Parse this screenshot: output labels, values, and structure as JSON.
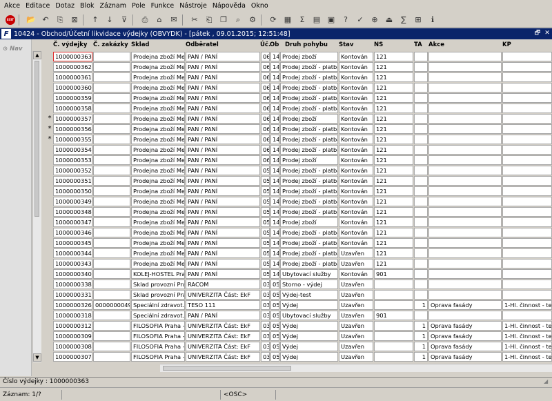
{
  "menu": [
    "Akce",
    "Editace",
    "Dotaz",
    "Blok",
    "Záznam",
    "Pole",
    "Funkce",
    "Nástroje",
    "Nápověda",
    "Okno"
  ],
  "toolbar": {
    "exit_label": "EXIT",
    "icons": [
      "open-icon",
      "back-icon",
      "copy-record-icon",
      "delete-record-icon",
      "sort-asc-icon",
      "sort-desc-icon",
      "filter-icon",
      "print-icon",
      "attach-icon",
      "mail-icon",
      "cut-icon",
      "paste-icon",
      "copy-icon",
      "search-icon",
      "settings-icon",
      "refresh-icon",
      "calculator-icon",
      "sum-icon",
      "chart-icon",
      "calendar-icon",
      "help-icon",
      "spellcheck-icon",
      "zoom-icon",
      "exit-icon",
      "sigma-icon",
      "excel-icon",
      "info-icon"
    ]
  },
  "window": {
    "logo": "F",
    "title": "10424 - Obchod/Účetní likvidace výdejky (OBVYDK) - [pátek  , 09.01.2015; 12:51:48]",
    "buttons": [
      "restore-icon",
      "close-icon"
    ],
    "restore_glyph": "🗗",
    "close_glyph": "✕"
  },
  "nav": {
    "label": "Nav"
  },
  "grid": {
    "columns": [
      "Č. výdejky",
      "Č. zakázky",
      "Sklad",
      "Odběratel",
      "Úč.",
      "Ob",
      "Druh pohybu",
      "Stav",
      "NS",
      "TA",
      "Akce",
      "KP"
    ],
    "rows": [
      {
        "mark": "",
        "vyd": "1000000363",
        "zak": "",
        "sklad": "Prodejna zboží Med",
        "odb": "PAN / PANÍ",
        "uc": "06",
        "ob": "14",
        "druh": "Prodej zboží",
        "stav": "Kontován",
        "ns": "121",
        "ta": "",
        "akce": "",
        "kp": ""
      },
      {
        "mark": "",
        "vyd": "1000000362",
        "zak": "",
        "sklad": "Prodejna zboží Med",
        "odb": "PAN / PANÍ",
        "uc": "06",
        "ob": "14",
        "druh": "Prodej zboží - platba k",
        "stav": "Kontován",
        "ns": "121",
        "ta": "",
        "akce": "",
        "kp": ""
      },
      {
        "mark": "",
        "vyd": "1000000361",
        "zak": "",
        "sklad": "Prodejna zboží Med",
        "odb": "PAN / PANÍ",
        "uc": "06",
        "ob": "14",
        "druh": "Prodej zboží - platba k",
        "stav": "Kontován",
        "ns": "121",
        "ta": "",
        "akce": "",
        "kp": ""
      },
      {
        "mark": "",
        "vyd": "1000000360",
        "zak": "",
        "sklad": "Prodejna zboží Med",
        "odb": "PAN / PANÍ",
        "uc": "06",
        "ob": "14",
        "druh": "Prodej zboží - platba k",
        "stav": "Kontován",
        "ns": "121",
        "ta": "",
        "akce": "",
        "kp": ""
      },
      {
        "mark": "",
        "vyd": "1000000359",
        "zak": "",
        "sklad": "Prodejna zboží Med",
        "odb": "PAN / PANÍ",
        "uc": "06",
        "ob": "14",
        "druh": "Prodej zboží - platba k",
        "stav": "Kontován",
        "ns": "121",
        "ta": "",
        "akce": "",
        "kp": ""
      },
      {
        "mark": "",
        "vyd": "1000000358",
        "zak": "",
        "sklad": "Prodejna zboží Med",
        "odb": "PAN / PANÍ",
        "uc": "06",
        "ob": "14",
        "druh": "Prodej zboží - platba k",
        "stav": "Kontován",
        "ns": "121",
        "ta": "",
        "akce": "",
        "kp": ""
      },
      {
        "mark": "*",
        "vyd": "1000000357",
        "zak": "",
        "sklad": "Prodejna zboží Med",
        "odb": "PAN / PANÍ",
        "uc": "06",
        "ob": "14",
        "druh": "Prodej zboží",
        "stav": "Kontován",
        "ns": "121",
        "ta": "",
        "akce": "",
        "kp": ""
      },
      {
        "mark": "*",
        "vyd": "1000000356",
        "zak": "",
        "sklad": "Prodejna zboží Med",
        "odb": "PAN / PANÍ",
        "uc": "06",
        "ob": "14",
        "druh": "Prodej zboží - platba k",
        "stav": "Kontován",
        "ns": "121",
        "ta": "",
        "akce": "",
        "kp": ""
      },
      {
        "mark": "*",
        "vyd": "1000000355",
        "zak": "",
        "sklad": "Prodejna zboží Med",
        "odb": "PAN / PANÍ",
        "uc": "06",
        "ob": "14",
        "druh": "Prodej zboží - platba k",
        "stav": "Kontován",
        "ns": "121",
        "ta": "",
        "akce": "",
        "kp": ""
      },
      {
        "mark": "",
        "vyd": "1000000354",
        "zak": "",
        "sklad": "Prodejna zboží Med",
        "odb": "PAN / PANÍ",
        "uc": "06",
        "ob": "14",
        "druh": "Prodej zboží - platba k",
        "stav": "Kontován",
        "ns": "121",
        "ta": "",
        "akce": "",
        "kp": ""
      },
      {
        "mark": "",
        "vyd": "1000000353",
        "zak": "",
        "sklad": "Prodejna zboží Med",
        "odb": "PAN / PANÍ",
        "uc": "06",
        "ob": "14",
        "druh": "Prodej zboží",
        "stav": "Kontován",
        "ns": "121",
        "ta": "",
        "akce": "",
        "kp": ""
      },
      {
        "mark": "",
        "vyd": "1000000352",
        "zak": "",
        "sklad": "Prodejna zboží Med",
        "odb": "PAN / PANÍ",
        "uc": "05",
        "ob": "14",
        "druh": "Prodej zboží - platba k",
        "stav": "Kontován",
        "ns": "121",
        "ta": "",
        "akce": "",
        "kp": ""
      },
      {
        "mark": "",
        "vyd": "1000000351",
        "zak": "",
        "sklad": "Prodejna zboží Med",
        "odb": "PAN / PANÍ",
        "uc": "05",
        "ob": "14",
        "druh": "Prodej zboží - platba k",
        "stav": "Kontován",
        "ns": "121",
        "ta": "",
        "akce": "",
        "kp": ""
      },
      {
        "mark": "",
        "vyd": "1000000350",
        "zak": "",
        "sklad": "Prodejna zboží Med",
        "odb": "PAN / PANÍ",
        "uc": "05",
        "ob": "14",
        "druh": "Prodej zboží - platba k",
        "stav": "Kontován",
        "ns": "121",
        "ta": "",
        "akce": "",
        "kp": ""
      },
      {
        "mark": "",
        "vyd": "1000000349",
        "zak": "",
        "sklad": "Prodejna zboží Med",
        "odb": "PAN / PANÍ",
        "uc": "05",
        "ob": "14",
        "druh": "Prodej zboží - platba k",
        "stav": "Kontován",
        "ns": "121",
        "ta": "",
        "akce": "",
        "kp": ""
      },
      {
        "mark": "",
        "vyd": "1000000348",
        "zak": "",
        "sklad": "Prodejna zboží Med",
        "odb": "PAN / PANÍ",
        "uc": "05",
        "ob": "14",
        "druh": "Prodej zboží - platba k",
        "stav": "Kontován",
        "ns": "121",
        "ta": "",
        "akce": "",
        "kp": ""
      },
      {
        "mark": "",
        "vyd": "1000000347",
        "zak": "",
        "sklad": "Prodejna zboží Med",
        "odb": "PAN / PANÍ",
        "uc": "05",
        "ob": "14",
        "druh": "Prodej zboží",
        "stav": "Kontován",
        "ns": "121",
        "ta": "",
        "akce": "",
        "kp": ""
      },
      {
        "mark": "",
        "vyd": "1000000346",
        "zak": "",
        "sklad": "Prodejna zboží Med",
        "odb": "PAN / PANÍ",
        "uc": "05",
        "ob": "14",
        "druh": "Prodej zboží - platba k",
        "stav": "Kontován",
        "ns": "121",
        "ta": "",
        "akce": "",
        "kp": ""
      },
      {
        "mark": "",
        "vyd": "1000000345",
        "zak": "",
        "sklad": "Prodejna zboží Med",
        "odb": "PAN / PANÍ",
        "uc": "05",
        "ob": "14",
        "druh": "Prodej zboží - platba k",
        "stav": "Kontován",
        "ns": "121",
        "ta": "",
        "akce": "",
        "kp": ""
      },
      {
        "mark": "",
        "vyd": "1000000344",
        "zak": "",
        "sklad": "Prodejna zboží Med",
        "odb": "PAN / PANÍ",
        "uc": "05",
        "ob": "14",
        "druh": "Prodej zboží - platba k",
        "stav": "Uzavřen",
        "ns": "121",
        "ta": "",
        "akce": "",
        "kp": ""
      },
      {
        "mark": "",
        "vyd": "1000000343",
        "zak": "",
        "sklad": "Prodejna zboží Med",
        "odb": "PAN / PANÍ",
        "uc": "05",
        "ob": "14",
        "druh": "Prodej zboží - platba k",
        "stav": "Uzavřen",
        "ns": "121",
        "ta": "",
        "akce": "",
        "kp": ""
      },
      {
        "mark": "",
        "vyd": "1000000340",
        "zak": "",
        "sklad": "KOLEJ-HOSTEL Pra",
        "odb": "PAN / PANÍ",
        "uc": "05",
        "ob": "14",
        "druh": "Ubytovací služby",
        "stav": "Kontován",
        "ns": "901",
        "ta": "",
        "akce": "",
        "kp": ""
      },
      {
        "mark": "",
        "vyd": "1000000338",
        "zak": "",
        "sklad": "Sklad provozní Pra",
        "odb": "RACOM",
        "uc": "03",
        "ob": "05",
        "druh": "Storno - výdej",
        "stav": "Uzavřen",
        "ns": "",
        "ta": "",
        "akce": "",
        "kp": ""
      },
      {
        "mark": "",
        "vyd": "1000000331",
        "zak": "",
        "sklad": "Sklad provozní Pra",
        "odb": "UNIVERZITA Část: EkF",
        "uc": "03",
        "ob": "05",
        "druh": "Výdej-test",
        "stav": "Uzavřen",
        "ns": "",
        "ta": "",
        "akce": "",
        "kp": ""
      },
      {
        "mark": "",
        "vyd": "1000000326",
        "zak": "0000000049",
        "sklad": "Speciální zdravot. n",
        "odb": "TESO 111",
        "uc": "03",
        "ob": "05",
        "druh": "Výdej",
        "stav": "Uzavřen",
        "ns": "",
        "ta": "1",
        "akce": "Oprava fasády",
        "kp": "1-Hl. činnost - tes"
      },
      {
        "mark": "",
        "vyd": "1000000318",
        "zak": "",
        "sklad": "Speciální zdravot. n",
        "odb": "PAN / PANÍ",
        "uc": "03",
        "ob": "05",
        "druh": "Ubytovací služby",
        "stav": "Uzavřen",
        "ns": "901",
        "ta": "",
        "akce": "",
        "kp": ""
      },
      {
        "mark": "",
        "vyd": "1000000312",
        "zak": "",
        "sklad": "FILOSOFIA Praha -",
        "odb": "UNIVERZITA Část: EkF",
        "uc": "03",
        "ob": "05",
        "druh": "Výdej",
        "stav": "Uzavřen",
        "ns": "",
        "ta": "1",
        "akce": "Oprava fasády",
        "kp": "1-Hl. činnost - tes"
      },
      {
        "mark": "",
        "vyd": "1000000309",
        "zak": "",
        "sklad": "FILOSOFIA Praha -",
        "odb": "UNIVERZITA Část: EkF",
        "uc": "03",
        "ob": "05",
        "druh": "Výdej",
        "stav": "Uzavřen",
        "ns": "",
        "ta": "1",
        "akce": "Oprava fasády",
        "kp": "1-Hl. činnost - tes"
      },
      {
        "mark": "",
        "vyd": "1000000308",
        "zak": "",
        "sklad": "FILOSOFIA Praha -",
        "odb": "UNIVERZITA Část: EkF",
        "uc": "03",
        "ob": "05",
        "druh": "Výdej",
        "stav": "Uzavřen",
        "ns": "",
        "ta": "1",
        "akce": "Oprava fasády",
        "kp": "1-Hl. činnost - tes"
      },
      {
        "mark": "",
        "vyd": "1000000307",
        "zak": "",
        "sklad": "FILOSOFIA Praha -",
        "odb": "UNIVERZITA Část: EkF",
        "uc": "03",
        "ob": "05",
        "druh": "Výdej",
        "stav": "Uzavřen",
        "ns": "",
        "ta": "1",
        "akce": "Oprava fasády",
        "kp": "1-Hl. činnost - tes"
      }
    ]
  },
  "status": {
    "field_info": "Číslo výdejky : 1000000363",
    "record": "Záznam: 1/?",
    "mode": "<OSC>"
  },
  "colors": {
    "title_bar": "#0a246a",
    "selected_border": "#e03030",
    "exit": "#c80000"
  }
}
